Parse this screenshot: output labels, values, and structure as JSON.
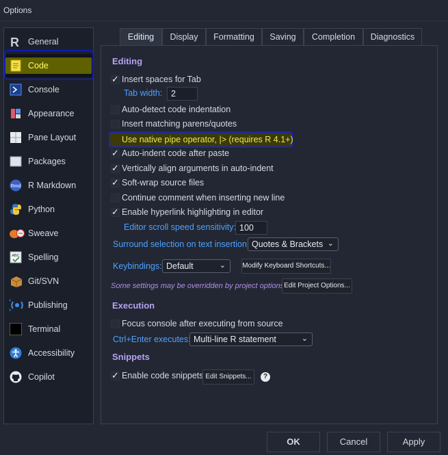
{
  "window": {
    "title": "Options"
  },
  "sidebar": {
    "items": [
      {
        "label": "General",
        "icon": "r-logo-icon"
      },
      {
        "label": "Code",
        "icon": "code-icon",
        "selected": true
      },
      {
        "label": "Console",
        "icon": "console-icon"
      },
      {
        "label": "Appearance",
        "icon": "appearance-icon"
      },
      {
        "label": "Pane Layout",
        "icon": "pane-layout-icon"
      },
      {
        "label": "Packages",
        "icon": "packages-icon"
      },
      {
        "label": "R Markdown",
        "icon": "rmd-icon",
        "icon_text": "Rmd"
      },
      {
        "label": "Python",
        "icon": "python-icon"
      },
      {
        "label": "Sweave",
        "icon": "sweave-icon"
      },
      {
        "label": "Spelling",
        "icon": "spelling-icon",
        "icon_text": "ABC"
      },
      {
        "label": "Git/SVN",
        "icon": "git-svn-icon"
      },
      {
        "label": "Publishing",
        "icon": "publishing-icon"
      },
      {
        "label": "Terminal",
        "icon": "terminal-icon"
      },
      {
        "label": "Accessibility",
        "icon": "accessibility-icon"
      },
      {
        "label": "Copilot",
        "icon": "github-icon"
      }
    ]
  },
  "tabs": [
    {
      "label": "Editing",
      "active": true
    },
    {
      "label": "Display"
    },
    {
      "label": "Formatting"
    },
    {
      "label": "Saving"
    },
    {
      "label": "Completion"
    },
    {
      "label": "Diagnostics"
    }
  ],
  "editing": {
    "header": "Editing",
    "insert_spaces": {
      "label": "Insert spaces for Tab",
      "checked": true
    },
    "tab_width": {
      "label": "Tab width:",
      "value": "2"
    },
    "auto_detect": {
      "label": "Auto-detect code indentation",
      "checked": false
    },
    "matching_parens": {
      "label": "Insert matching parens/quotes",
      "checked": false
    },
    "native_pipe": {
      "label": "Use native pipe operator, |> (requires R 4.1+)",
      "checked": false
    },
    "auto_indent": {
      "label": "Auto-indent code after paste",
      "checked": true
    },
    "vertical_align": {
      "label": "Vertically align arguments in auto-indent",
      "checked": true
    },
    "soft_wrap": {
      "label": "Soft-wrap source files",
      "checked": true
    },
    "continue_comment": {
      "label": "Continue comment when inserting new line",
      "checked": false
    },
    "hyperlink": {
      "label": "Enable hyperlink highlighting in editor",
      "checked": true
    },
    "scroll_speed": {
      "label": "Editor scroll speed sensitivity:",
      "value": "100"
    },
    "surround": {
      "label": "Surround selection on text insertion:",
      "value": "Quotes & Brackets"
    },
    "keybindings": {
      "label": "Keybindings:",
      "value": "Default",
      "modify_label": "Modify Keyboard Shortcuts..."
    },
    "note": "Some settings may be overridden by project options.",
    "edit_project_label": "Edit Project Options..."
  },
  "execution": {
    "header": "Execution",
    "focus_console": {
      "label": "Focus console after executing from source",
      "checked": false
    },
    "ctrl_enter": {
      "label": "Ctrl+Enter executes:",
      "value": "Multi-line R statement"
    }
  },
  "snippets": {
    "header": "Snippets",
    "enable": {
      "label": "Enable code snippets",
      "checked": true
    },
    "edit_label": "Edit Snippets...",
    "help": "?"
  },
  "footer": {
    "ok": "OK",
    "cancel": "Cancel",
    "apply": "Apply"
  },
  "colors": {
    "accent": "#b6a2f2",
    "link": "#4ea2ff",
    "highlight_yellow": "#ffff66",
    "outline_blue": "#1922c6"
  }
}
